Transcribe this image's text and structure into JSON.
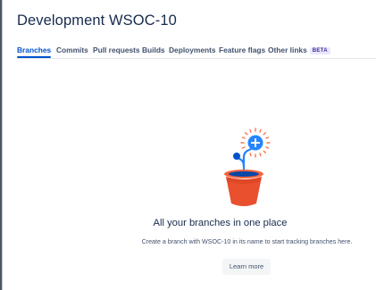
{
  "dialog": {
    "title": "Development WSOC-10"
  },
  "tabs": [
    {
      "label": "Branches",
      "active": true
    },
    {
      "label": "Commits"
    },
    {
      "label": "Pull requests"
    },
    {
      "label": "Builds"
    },
    {
      "label": "Deployments"
    },
    {
      "label": "Feature flags"
    },
    {
      "label": "Other links",
      "badge": "BETA"
    }
  ],
  "empty_state": {
    "illustration": "plant-pot-with-branch-icon",
    "heading": "All your branches in one place",
    "description": "Create a branch with WSOC-10 in its name to start tracking branches here.",
    "button_label": "Learn more"
  },
  "colors": {
    "accent": "#0052cc",
    "pot": "#e8502e",
    "pot_rim": "#f7643c",
    "stem": "#2684ff",
    "burst": "#ff7452",
    "badge_bg": "#eae6ff",
    "badge_text": "#403294"
  }
}
